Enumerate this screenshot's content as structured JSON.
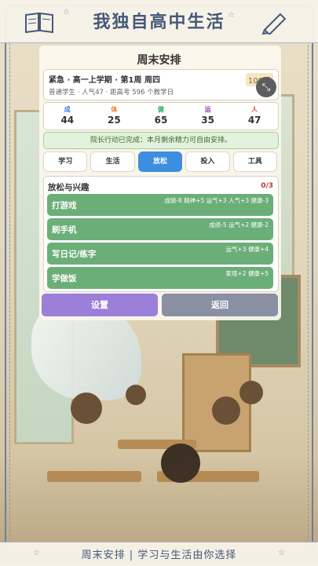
{
  "header": {
    "title": "我独自高中生活"
  },
  "panel": {
    "title": "周末安排"
  },
  "info": {
    "line1": "紧急 · 高一上学期 · 第1周 周四",
    "line2": "普通学生 · 人气47 · 距高考 596 个教学日",
    "money": "100元"
  },
  "stats": [
    {
      "label": "成",
      "value": "44",
      "color": "#3a7bd5"
    },
    {
      "label": "体",
      "value": "25",
      "color": "#e67e22"
    },
    {
      "label": "健",
      "value": "65",
      "color": "#27ae60"
    },
    {
      "label": "运",
      "value": "35",
      "color": "#8e44ad"
    },
    {
      "label": "人",
      "value": "47",
      "color": "#e74c3c"
    }
  ],
  "notice": "院长行动已完成：本月剩余精力可自由安排。",
  "tabs": [
    {
      "label": "学习",
      "active": false
    },
    {
      "label": "生活",
      "active": false
    },
    {
      "label": "放松",
      "active": true
    },
    {
      "label": "投入",
      "active": false
    },
    {
      "label": "工具",
      "active": false
    }
  ],
  "section": {
    "title": "放松与兴趣",
    "count": "0/3",
    "activities": [
      {
        "name": "打游戏",
        "effect": "成绩-8 精神+5 运气+3 人气+3 健康-3"
      },
      {
        "name": "刷手机",
        "effect": "成绩-5 运气+2 健康-2"
      },
      {
        "name": "写日记/练字",
        "effect": "运气+3 健康+4"
      },
      {
        "name": "学做饭",
        "effect": "家境+2 健康+5"
      }
    ]
  },
  "buttons": {
    "settings": "设置",
    "back": "返回"
  },
  "footer": {
    "text": "周末安排 | 学习与生活由你选择"
  }
}
